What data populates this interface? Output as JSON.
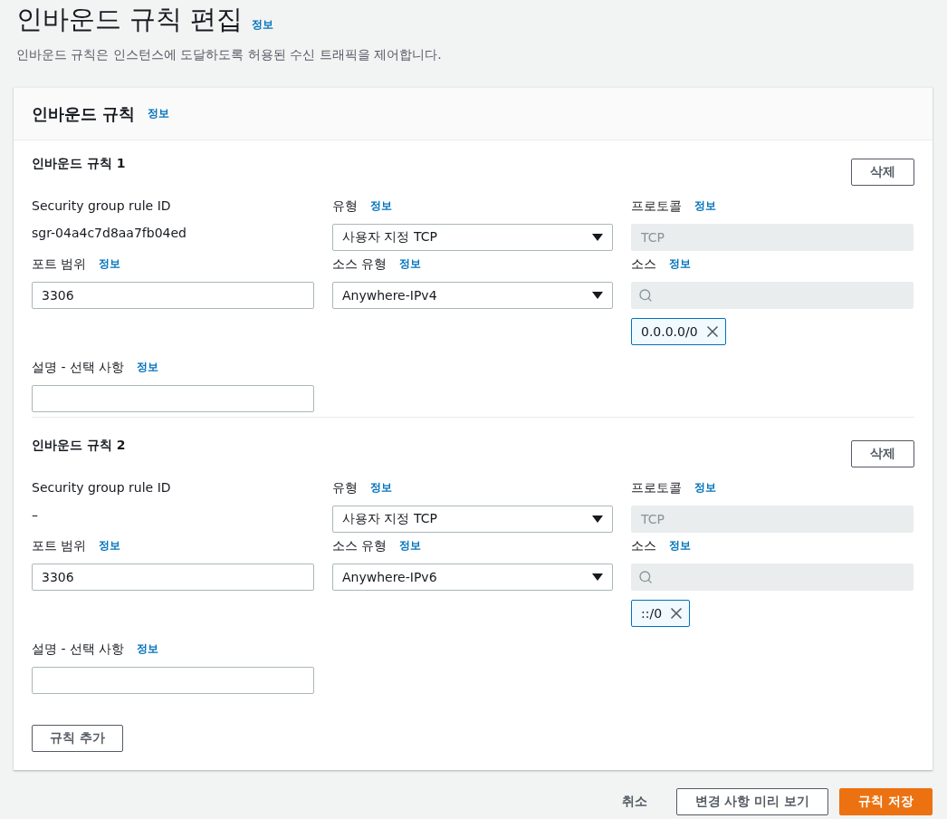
{
  "page": {
    "title": "인바운드 규칙 편집",
    "info": "정보",
    "description": "인바운드 규칙은 인스턴스에 도달하도록 허용된 수신 트래픽을 제어합니다."
  },
  "panel": {
    "title": "인바운드 규칙",
    "info": "정보"
  },
  "rules": [
    {
      "title": "인바운드 규칙 1",
      "delete_button": "삭제",
      "fields": [
        {
          "kind": "text",
          "label": "Security group rule ID",
          "value": "sgr-04a4c7d8aa7fb04ed"
        },
        {
          "kind": "select",
          "label": "유형",
          "info": "정보",
          "value": "사용자 지정 TCP"
        },
        {
          "kind": "readonly",
          "label": "프로토콜",
          "info": "정보",
          "value": "TCP"
        },
        {
          "kind": "input",
          "label": "포트 범위",
          "info": "정보",
          "value": "3306"
        },
        {
          "kind": "select",
          "label": "소스 유형",
          "info": "정보",
          "value": "Anywhere-IPv4"
        },
        {
          "kind": "search",
          "label": "소스",
          "info": "정보",
          "tokens": [
            "0.0.0.0/0"
          ]
        }
      ],
      "description": {
        "label": "설명 - 선택 사항",
        "info": "정보"
      }
    },
    {
      "title": "인바운드 규칙 2",
      "delete_button": "삭제",
      "fields": [
        {
          "kind": "text",
          "label": "Security group rule ID",
          "value": "–"
        },
        {
          "kind": "select",
          "label": "유형",
          "info": "정보",
          "value": "사용자 지정 TCP"
        },
        {
          "kind": "readonly",
          "label": "프로토콜",
          "info": "정보",
          "value": "TCP"
        },
        {
          "kind": "input",
          "label": "포트 범위",
          "info": "정보",
          "value": "3306"
        },
        {
          "kind": "select",
          "label": "소스 유형",
          "info": "정보",
          "value": "Anywhere-IPv6"
        },
        {
          "kind": "search",
          "label": "소스",
          "info": "정보",
          "tokens": [
            "::/0"
          ]
        }
      ],
      "description": {
        "label": "설명 - 선택 사항",
        "info": "정보"
      }
    }
  ],
  "add_rule_button": "규칙 추가",
  "footer": {
    "cancel": "취소",
    "preview": "변경 사항 미리 보기",
    "save": "규칙 저장"
  }
}
